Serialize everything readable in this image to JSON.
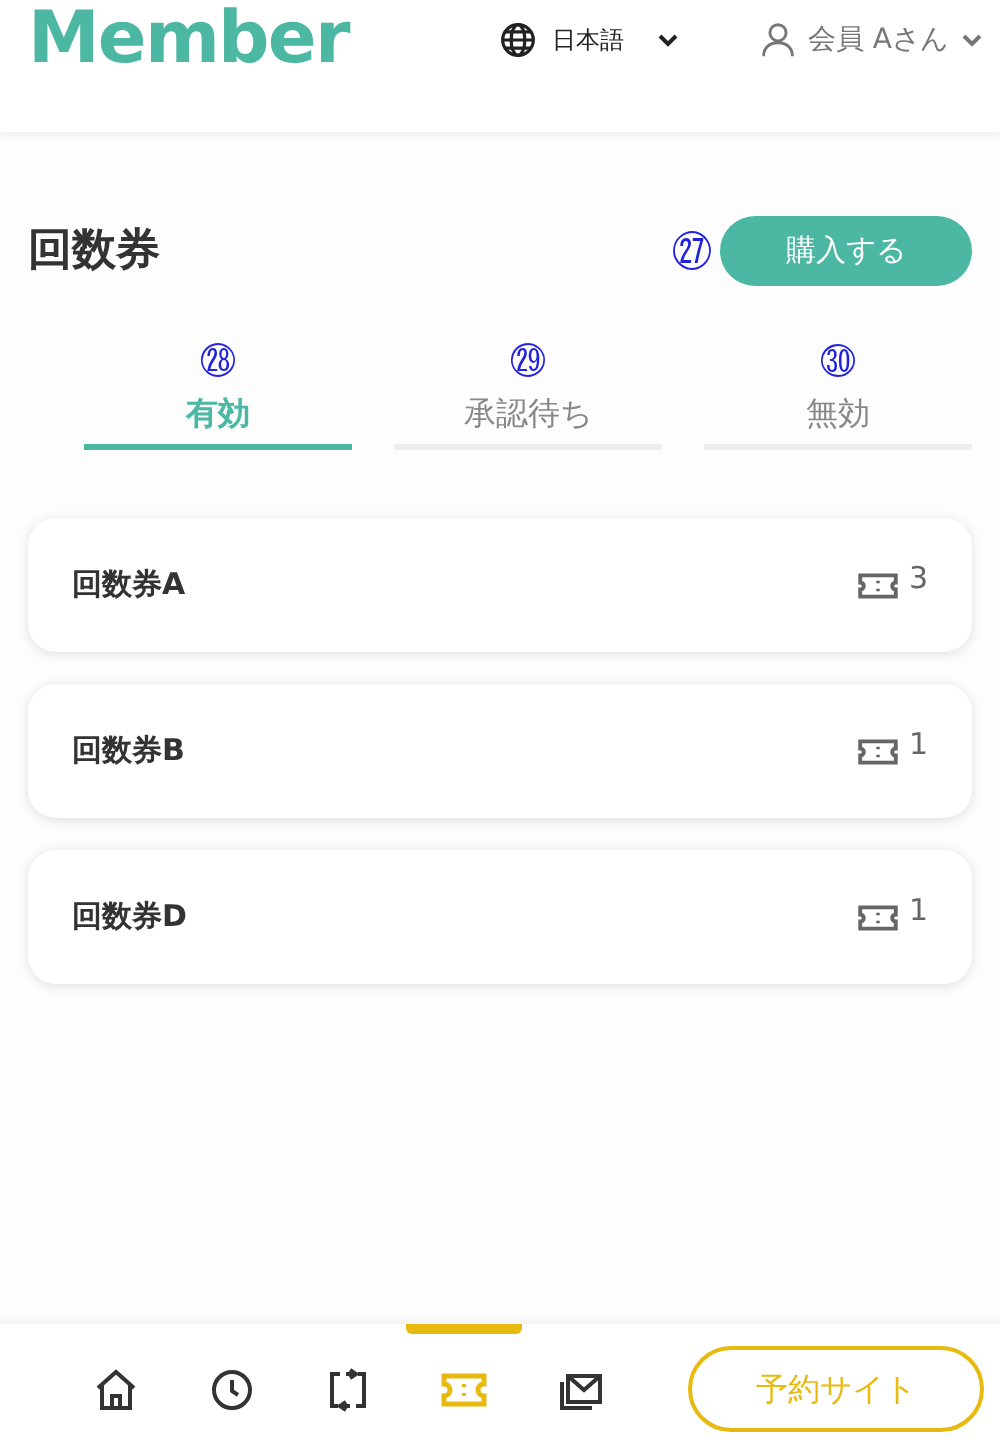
{
  "header": {
    "logo": "Member",
    "language": {
      "label": "日本語"
    },
    "user": {
      "label": "会員 Aさん"
    }
  },
  "page": {
    "title": "回数券",
    "purchase_button": {
      "label": "購入する",
      "annotation": "㉗"
    }
  },
  "tabs": [
    {
      "label": "有効",
      "annotation": "㉘",
      "selected": true
    },
    {
      "label": "承認待ち",
      "annotation": "㉙",
      "selected": false
    },
    {
      "label": "無効",
      "annotation": "㉚",
      "selected": false
    }
  ],
  "tickets": [
    {
      "name": "回数券A",
      "count": "3"
    },
    {
      "name": "回数券B",
      "count": "1"
    },
    {
      "name": "回数券D",
      "count": "1"
    }
  ],
  "bottom_nav": {
    "items": [
      {
        "kind": "home",
        "selected": false
      },
      {
        "kind": "history",
        "selected": false
      },
      {
        "kind": "transfer",
        "selected": false
      },
      {
        "kind": "ticket",
        "selected": true
      },
      {
        "kind": "mail",
        "selected": false
      }
    ],
    "booking_button": {
      "label": "予約サイト"
    }
  }
}
